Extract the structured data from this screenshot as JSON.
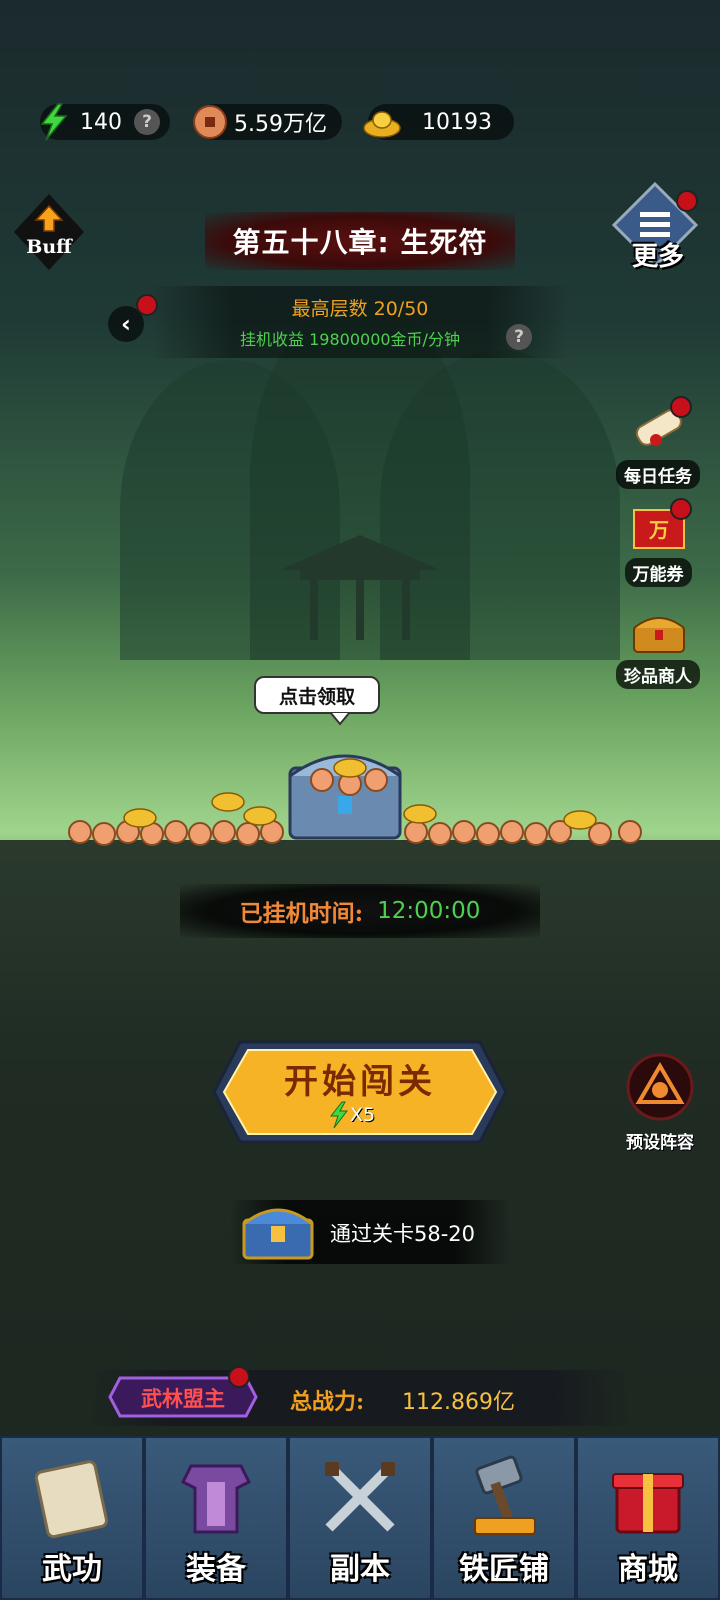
{
  "resources": {
    "energy": "140",
    "coins": "5.59万亿",
    "gold": "10193"
  },
  "buff_label": "Buff",
  "more_label": "更多",
  "chapter_title": "第五十八章: 生死符",
  "max_floor": "最高层数 20/50",
  "idle_income": "挂机收益 19800000金币/分钟",
  "side_menu": [
    {
      "label": "每日任务"
    },
    {
      "label": "万能券"
    },
    {
      "label": "珍品商人"
    }
  ],
  "claim_tip": "点击领取",
  "idle_time_label": "已挂机时间:",
  "idle_time_value": "12:00:00",
  "start_button": {
    "label": "开始闯关",
    "cost": "X5"
  },
  "preset_lineup_label": "预设阵容",
  "reward_text": "通过关卡58-20",
  "rank_title": "武林盟主",
  "total_power_label": "总战力:",
  "total_power_value": "112.869亿",
  "nav": [
    {
      "label": "武功"
    },
    {
      "label": "装备"
    },
    {
      "label": "副本"
    },
    {
      "label": "铁匠铺"
    },
    {
      "label": "商城"
    }
  ],
  "colors": {
    "highlight_orange": "#f0a020",
    "green_text": "#4fd04f",
    "badge_red": "#c8101a"
  }
}
